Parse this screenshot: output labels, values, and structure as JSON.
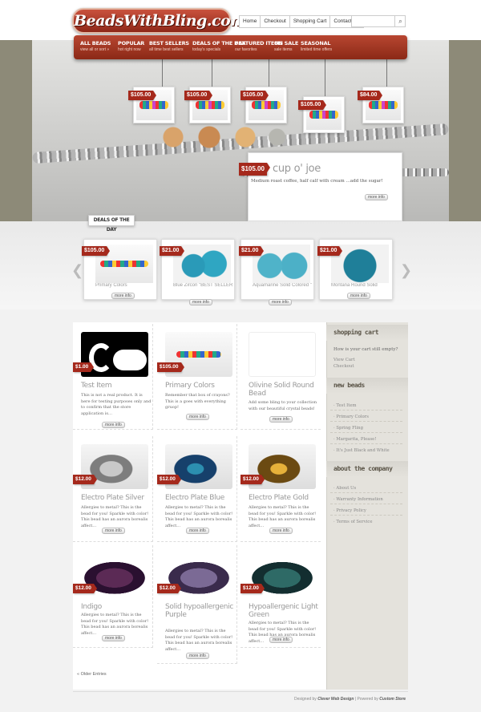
{
  "header": {
    "logo_text": "BeadsWithBling.com",
    "top_nav": [
      "Home",
      "Checkout",
      "Shopping Cart",
      "Contact Us"
    ],
    "search": {
      "placeholder": "",
      "value": ""
    }
  },
  "main_nav": [
    {
      "title": "ALL BEADS",
      "sub": "view all or sort »"
    },
    {
      "title": "POPULAR",
      "sub": "hot right now"
    },
    {
      "title": "BEST SELLERS",
      "sub": "all time best sellers"
    },
    {
      "title": "DEALS OF THE DAY",
      "sub": "today's specials"
    },
    {
      "title": "FEATURED ITEMS",
      "sub": "our favorites"
    },
    {
      "title": "ON SALE",
      "sub": "sale items"
    },
    {
      "title": "SEASONAL",
      "sub": "limited time offers"
    }
  ],
  "hero": {
    "hanging_prices": [
      "$105.00",
      "$105.00",
      "$105.00",
      "$105.00",
      "$84.00"
    ],
    "feature": {
      "price": "$105.00",
      "title": "cup o' joe",
      "desc": "Medium roast coffee, half calf with cream …add the sugar!",
      "more": "more info"
    }
  },
  "deals": {
    "label": "DEALS OF THE DAY",
    "items": [
      {
        "price": "$105.00",
        "name": "Primary Colors",
        "more": "more info"
      },
      {
        "price": "$21.00",
        "name": "Blue Zircon \"BEST SELLER\"",
        "more": "more info"
      },
      {
        "price": "$21.00",
        "name": "Aquamarine Solid Colored \"HOT SELLER\"",
        "more": "more info"
      },
      {
        "price": "$21.00",
        "name": "Montana Round Solid",
        "more": "more info"
      }
    ]
  },
  "products": [
    {
      "price": "$1.00",
      "name": "Test Item",
      "desc": "This is not a real product. It is here for testing purposes only and to confirm that the store application is…",
      "more": "more info",
      "img": "clever"
    },
    {
      "price": "$105.00",
      "name": "Primary Colors",
      "desc": "Remember that box of crayons? This is a goes with everything gruop!",
      "more": "more info",
      "img": "primary"
    },
    {
      "price": "",
      "name": "Olivine Solid Round Bead",
      "desc": "Add some bling to your collection with our beautiful crystal beads!",
      "more": "more info",
      "img": "blank"
    },
    {
      "price": "$12.00",
      "name": "Electro Plate Silver",
      "desc": "Allergies to metal? This is the bead for you! Sparkle with color! This bead has an aurora borealis affect…",
      "more": "more info",
      "img": "silver"
    },
    {
      "price": "$12.00",
      "name": "Electro Plate Blue",
      "desc": "Allergies to metal? This is the bead for you! Sparkle with color! This bead has an aurora borealis affect…",
      "more": "more info",
      "img": "blue"
    },
    {
      "price": "$12.00",
      "name": "Electro Plate Gold",
      "desc": "Allergies to metal? This is the bead for you! Sparkle with color! This bead has an aurora borealis affect…",
      "more": "more info",
      "img": "gold"
    },
    {
      "price": "$12.00",
      "name": "Indigo",
      "desc": "Allergies to metal? This is the bead for you! Sparkle with color! This bead has an aurora borealis affect…",
      "more": "more info",
      "img": "indigo"
    },
    {
      "price": "$12.00",
      "name": "Solid hypoallergenic Purple",
      "desc": "Allergies to metal? This is the bead for you! Sparkle with color! This bead has an aurora borealis affect…",
      "more": "more info",
      "img": "purple"
    },
    {
      "price": "$12.00",
      "name": "Hypoallergenic Light Green",
      "desc": "Allergies to metal? This is the bead for you! Sparkle with color! This bead has an aurora borealis affect…",
      "more": "more info",
      "img": "green"
    }
  ],
  "older_entries": "« Older Entries",
  "sidebar": {
    "cart": {
      "title": "shopping cart",
      "text": "How is your cart still empty?",
      "links": [
        "View Cart",
        "Checkout"
      ]
    },
    "new_beads": {
      "title": "new beads",
      "links": [
        "Test Item",
        "Primary Colors",
        "Spring Fling",
        "Margarita, Please!",
        "It's Just Black and White"
      ]
    },
    "about": {
      "title": "about the company",
      "links": [
        "About Us",
        "Warranty Information",
        "Privacy Policy",
        "Terms of Service"
      ]
    }
  },
  "footer": {
    "designed_by": "Designed by",
    "designer": "Clever Web Design",
    "powered_by": "| Powered by",
    "platform": "Custom Store"
  },
  "colors": {
    "brand_red": "#a5291c",
    "sidebar_bg": "#e4e2dc"
  }
}
